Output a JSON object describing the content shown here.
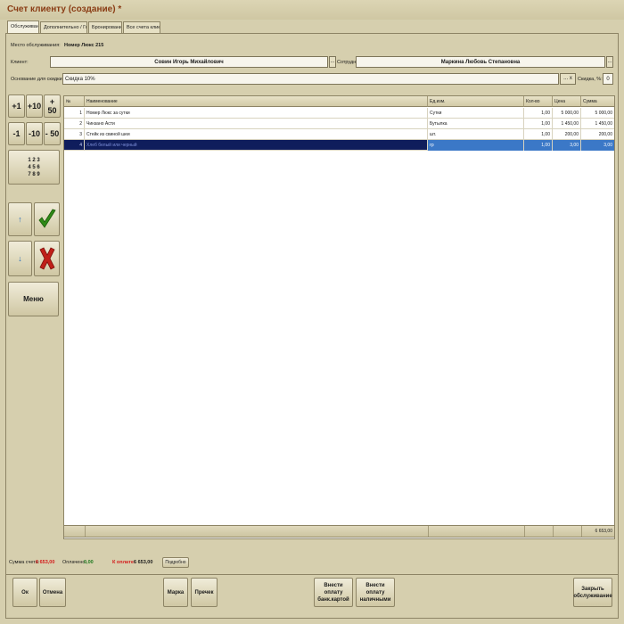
{
  "window": {
    "title": "Счет клиенту (создание) *"
  },
  "tabs": [
    {
      "label": "Обслуживание"
    },
    {
      "label": "Дополнительно / Гости"
    },
    {
      "label": "Бронирование"
    },
    {
      "label": "Все счета клиенту"
    }
  ],
  "form": {
    "place_label": "Место обслуживания:",
    "place_value": "Номер Люкс 215",
    "client_label": "Клиент:",
    "client_value": "Совин Игорь Михайлович",
    "employee_label": "Сотрудник:",
    "employee_value": "Маркина Любовь Степановна",
    "discount_basis_label": "Основание для скидки:",
    "discount_basis_value": "Скидка 10%",
    "discount_pct_label": "Скидка, %:",
    "discount_pct_value": "0",
    "ellipsis": "...",
    "ellipsis_x": "... x"
  },
  "keypad": {
    "plus1": "+1",
    "plus10": "+10",
    "plus50": "+ 50",
    "minus1": "-1",
    "minus10": "-10",
    "minus50": "- 50",
    "numpad_row1": "1 2 3",
    "numpad_row2": "4 5 6",
    "numpad_row3": "7 8 9",
    "up": "↑",
    "down": "↓",
    "menu": "Меню"
  },
  "grid": {
    "columns": [
      "№",
      "Наименование",
      "Ед.изм.",
      "Кол-во",
      "Цена",
      "Сумма"
    ],
    "rows": [
      {
        "n": "1",
        "name": "Номер Люкс за сутки",
        "unit": "Сутки",
        "qty": "1,00",
        "price": "5 000,00",
        "sum": "5 000,00"
      },
      {
        "n": "2",
        "name": "Чинзано Асти",
        "unit": "Бутылка",
        "qty": "1,00",
        "price": "1 450,00",
        "sum": "1 450,00"
      },
      {
        "n": "3",
        "name": "Стейк из свиной шеи",
        "unit": "шт.",
        "qty": "1,00",
        "price": "200,00",
        "sum": "200,00"
      },
      {
        "n": "4",
        "name": "Хлеб белый или черный",
        "unit": "гр",
        "qty": "1,00",
        "price": "3,00",
        "sum": "3,00"
      }
    ],
    "total": "6 653,00"
  },
  "summary": {
    "invoice_label": "Сумма счета:",
    "invoice_value": "6 653,00",
    "paid_label": "Оплачено:",
    "paid_value": "0,00",
    "due_label": "К оплате:",
    "due_value": "6 653,00",
    "details_button": "Подробно"
  },
  "buttons": {
    "ok": "Ок",
    "cancel": "Отмена",
    "mark": "Марка",
    "precheck": "Пречек",
    "pay_card_line1": "Внести оплату",
    "pay_card_line2": "банк.картой",
    "pay_cash_line1": "Внести оплату",
    "pay_cash_line2": "наличными",
    "close_line1": "Закрыть",
    "close_line2": "обслуживание"
  },
  "colors": {
    "title": "#8a3c14",
    "selected_row": "#0f1d5c",
    "check_green": "#2f8a17",
    "cross_red": "#c0201a",
    "amount_red": "#d41b1b",
    "paid_green": "#1f7a1f"
  }
}
